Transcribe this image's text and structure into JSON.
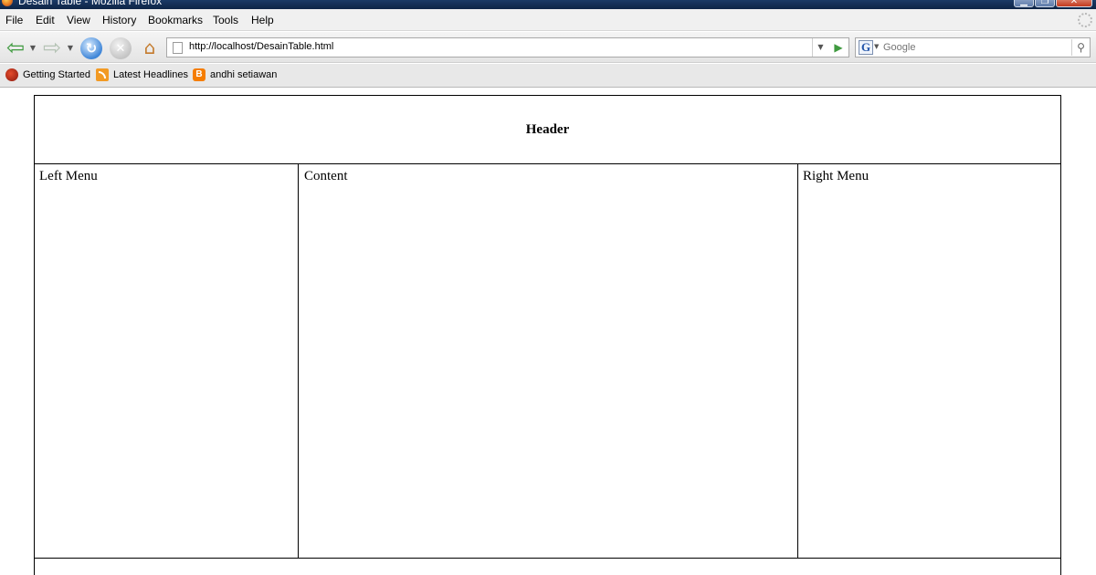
{
  "window": {
    "title": "Desain Table - Mozilla Firefox",
    "close_glyph": "✕",
    "min_glyph": "▁",
    "max_glyph": "❐"
  },
  "menu": {
    "items": [
      "File",
      "Edit",
      "View",
      "History",
      "Bookmarks",
      "Tools",
      "Help"
    ]
  },
  "navigation": {
    "url": "http://localhost/DesainTable.html",
    "search_placeholder": "Google",
    "search_engine_letter": "G"
  },
  "bookmarks": {
    "items": [
      {
        "label": "Getting Started",
        "icon": "firefox-icon"
      },
      {
        "label": "Latest Headlines",
        "icon": "rss-icon"
      },
      {
        "label": "andhi setiawan",
        "icon": "blogger-icon"
      }
    ],
    "blogger_letter": "B"
  },
  "page": {
    "header": "Header",
    "left_menu": "Left Menu",
    "content": "Content",
    "right_menu": "Right Menu",
    "footer": ""
  },
  "colors": {
    "title_bar": "#1b3a66",
    "table_border": "#000000",
    "page_background": "#ffffff"
  }
}
